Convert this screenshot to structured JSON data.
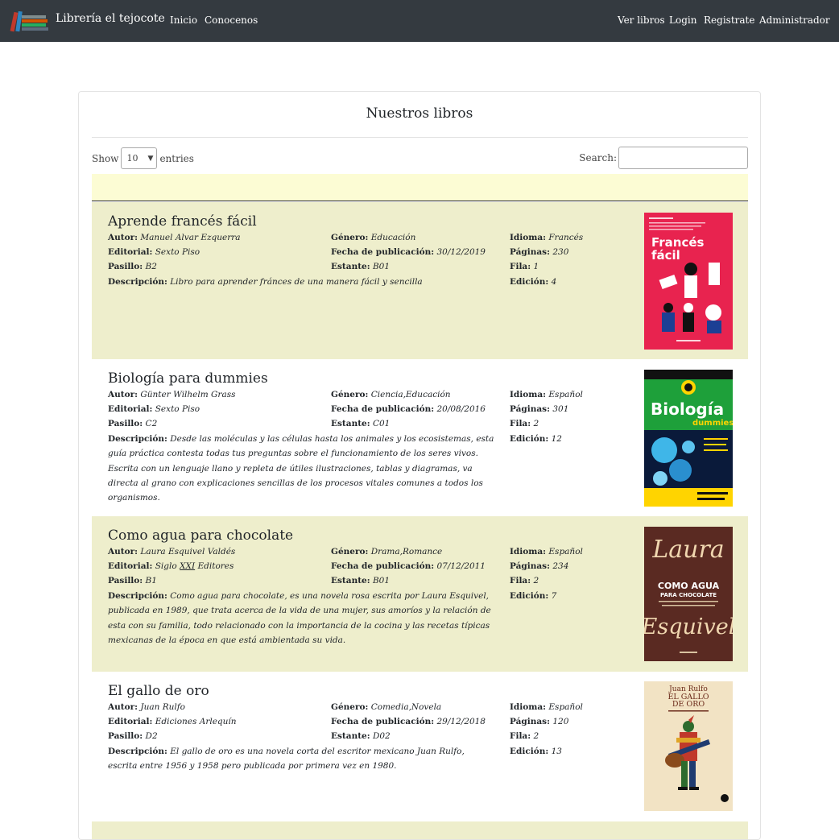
{
  "nav": {
    "brand": "Librería el tejocote",
    "links_left": [
      "Inicio",
      "Conocenos"
    ],
    "links_right": [
      "Ver libros",
      "Login",
      "Registrate",
      "Administrador"
    ]
  },
  "card": {
    "title": "Nuestros libros",
    "show_label": "Show",
    "entries_label": "entries",
    "page_length": "10",
    "search_label": "Search:",
    "search_value": ""
  },
  "labels": {
    "autor": "Autor:",
    "editorial": "Editorial:",
    "pasillo": "Pasillo:",
    "descripcion": "Descripción:",
    "genero": "Género:",
    "fecha": "Fecha de publicación:",
    "estante": "Estante:",
    "idioma": "Idioma:",
    "paginas": "Páginas:",
    "fila": "Fila:",
    "edicion": "Edición:"
  },
  "books": [
    {
      "title": "Aprende francés fácil",
      "autor": "Manuel Alvar Ezquerra",
      "editorial": "Sexto Piso",
      "pasillo": "B2",
      "descripcion": "Libro para aprender fránces de una manera fácil y sencilla",
      "genero": "Educación",
      "fecha": "30/12/2019",
      "estante": "B01",
      "idioma": "Francés",
      "paginas": "230",
      "fila": "1",
      "edicion": "4",
      "cover_text": [
        "Francés",
        "fácil"
      ]
    },
    {
      "title": "Biología para dummies",
      "autor": "Günter Wilhelm Grass",
      "editorial": "Sexto Piso",
      "pasillo": "C2",
      "descripcion": "Desde las moléculas y las células hasta los animales y los ecosistemas, esta guía práctica contesta todas tus preguntas sobre el funcionamiento de los seres vivos. Escrita con un lenguaje llano y repleta de útiles ilustraciones, tablas y diagramas, va directa al grano con explicaciones sencillas de los procesos vitales comunes a todos los organismos.",
      "genero": "Ciencia,Educación",
      "fecha": "20/08/2016",
      "estante": "C01",
      "idioma": "Español",
      "paginas": "301",
      "fila": "2",
      "edicion": "12",
      "cover_text": [
        "Biología",
        "dummies"
      ]
    },
    {
      "title": "Como agua para chocolate",
      "autor": "Laura Esquivel Valdés",
      "editorial_prefix": "Siglo",
      "editorial_underlined": "XXI",
      "editorial_suffix": "Editores",
      "pasillo": "B1",
      "descripcion": "Como agua para chocolate, es una novela rosa escrita por Laura Esquivel, publicada en 1989, que trata acerca de la vida de una mujer, sus amoríos y la relación de esta con su familia, todo relacionado con la importancia de la cocina y las recetas típicas mexicanas de la época en que está ambientada su vida.",
      "genero": "Drama,Romance",
      "fecha": "07/12/2011",
      "estante": "B01",
      "idioma": "Español",
      "paginas": "234",
      "fila": "2",
      "edicion": "7",
      "cover_text": [
        "Laura",
        "COMO AGUA",
        "PARA CHOCOLATE",
        "Esquivel"
      ]
    },
    {
      "title": "El gallo de oro",
      "autor": "Juan Rulfo",
      "editorial": "Ediciones Arlequín",
      "pasillo": "D2",
      "descripcion": "El gallo de oro es una novela corta del escritor mexicano Juan Rulfo, escrita entre 1956 y 1958 pero publicada por primera vez en 1980.",
      "genero": "Comedia,Novela",
      "fecha": "29/12/2018",
      "estante": "D02",
      "idioma": "Español",
      "paginas": "120",
      "fila": "2",
      "edicion": "13",
      "cover_text": [
        "Juan Rulfo",
        "EL GALLO",
        "DE ORO"
      ]
    }
  ],
  "colors": {
    "navbar": "#343a40",
    "row_striped": "#eeeecc",
    "table_head": "#fcfcd4"
  }
}
